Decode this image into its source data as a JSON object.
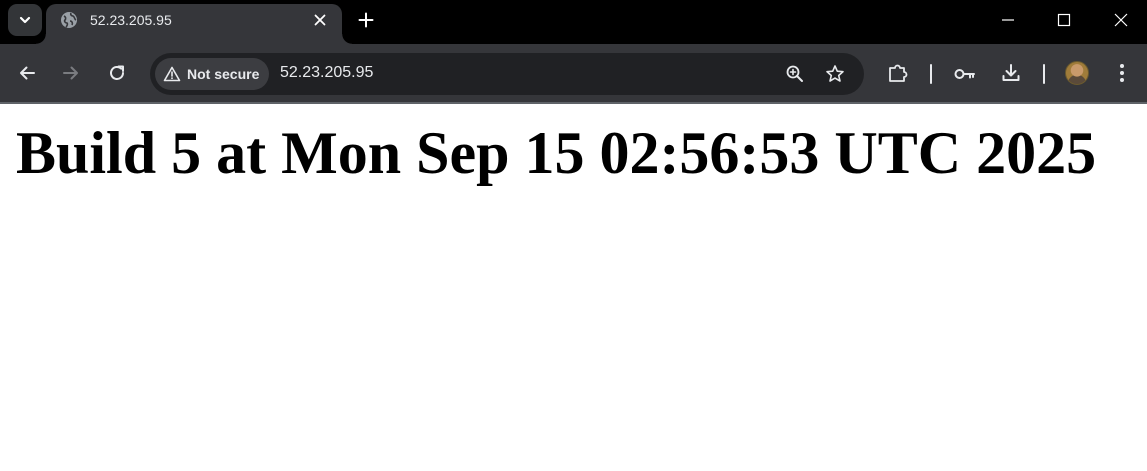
{
  "browser": {
    "tab": {
      "title": "52.23.205.95"
    },
    "address_bar": {
      "security_chip": "Not secure",
      "url": "52.23.205.95"
    },
    "icons": {
      "tab_search": "chevron-down-icon",
      "favicon": "globe-icon",
      "close_tab": "close-icon",
      "new_tab": "plus-icon",
      "minimize": "minimize-icon",
      "maximize": "maximize-icon",
      "close_window": "close-icon",
      "back": "arrow-left-icon",
      "forward": "arrow-right-icon",
      "reload": "reload-icon",
      "warning": "warning-icon",
      "zoom": "zoom-in-icon",
      "bookmark": "star-icon",
      "extensions": "puzzle-icon",
      "passwords": "key-icon",
      "downloads": "download-icon",
      "profile": "avatar",
      "menu": "kebab-menu-icon"
    },
    "colors": {
      "tabstrip_bg": "#000000",
      "toolbar_bg": "#35363a",
      "omnibox_bg": "#202124",
      "icon_fg": "#e8eaed"
    }
  },
  "page": {
    "heading": "Build 5 at Mon Sep 15 02:56:53 UTC 2025"
  }
}
